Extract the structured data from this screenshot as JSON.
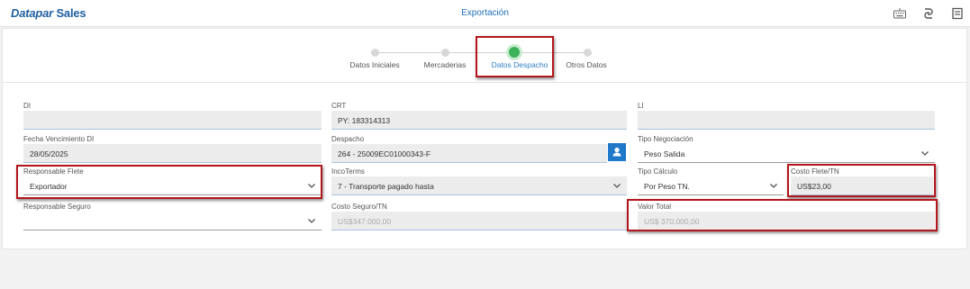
{
  "header": {
    "logo_part1": "Datapar",
    "logo_part2": "Sales",
    "title": "Exportación",
    "icons": [
      "keyboard-icon",
      "link-icon",
      "form-icon"
    ]
  },
  "stepper": {
    "steps": [
      {
        "label": "Datos Iniciales",
        "active": false
      },
      {
        "label": "Mercaderias",
        "active": false
      },
      {
        "label": "Datos Despacho",
        "active": true
      },
      {
        "label": "Otros Datos",
        "active": false
      }
    ]
  },
  "form": {
    "di": {
      "label": "DI",
      "value": ""
    },
    "crt": {
      "label": "CRT",
      "value": "PY: 183314313"
    },
    "li": {
      "label": "LI",
      "value": ""
    },
    "fecha_vencimiento_di": {
      "label": "Fecha Vencimiento DI",
      "value": "28/05/2025"
    },
    "despacho": {
      "label": "Despacho",
      "value": "264 - 25009EC01000343-F"
    },
    "tipo_negociacion": {
      "label": "Tipo Negociación",
      "value": "Peso Salida"
    },
    "responsable_flete": {
      "label": "Responsable Flete",
      "value": "Exportador"
    },
    "incoterms": {
      "label": "IncoTerms",
      "value": "7 - Transporte pagado hasta"
    },
    "tipo_calculo": {
      "label": "Tipo Cálculo",
      "value": "Por Peso TN."
    },
    "costo_flete_tn": {
      "label": "Costo Flete/TN",
      "value": "US$23,00"
    },
    "responsable_seguro": {
      "label": "Responsable Seguro",
      "value": ""
    },
    "costo_seguro_tn": {
      "label": "Costo Seguro/TN",
      "value": "US$347.000,00"
    },
    "valor_total": {
      "label": "Valor Total",
      "value": "US$ 370.000,00"
    }
  },
  "colors": {
    "brand": "#1f5fa0",
    "accent": "#1f78c8",
    "active_step": "#3db15a",
    "highlight": "#b3161c"
  }
}
